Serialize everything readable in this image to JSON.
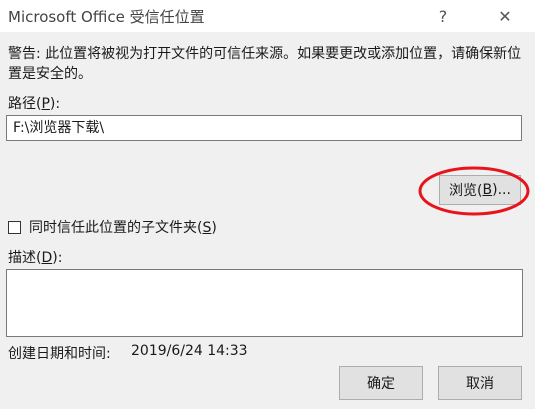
{
  "window": {
    "title": "Microsoft Office 受信任位置",
    "help_glyph": "?",
    "close_glyph": "✕"
  },
  "warning": "警告: 此位置将被视为打开文件的可信任来源。如果要更改或添加位置，请确保新位置是安全的。",
  "path": {
    "label_prefix": "路径(",
    "label_key": "P",
    "label_suffix": "):",
    "value": "F:\\浏览器下载\\"
  },
  "browse": {
    "label_prefix": "浏览(",
    "label_key": "B",
    "label_suffix": ")..."
  },
  "subfolders": {
    "label_prefix": "同时信任此位置的子文件夹(",
    "label_key": "S",
    "label_suffix": ")",
    "checked": false
  },
  "description": {
    "label_prefix": "描述(",
    "label_key": "D",
    "label_suffix": "):",
    "value": ""
  },
  "created": {
    "label": "创建日期和时间:",
    "value": "2019/6/24 14:33"
  },
  "buttons": {
    "ok": "确定",
    "cancel": "取消"
  },
  "annotation_color": "#e8141c"
}
